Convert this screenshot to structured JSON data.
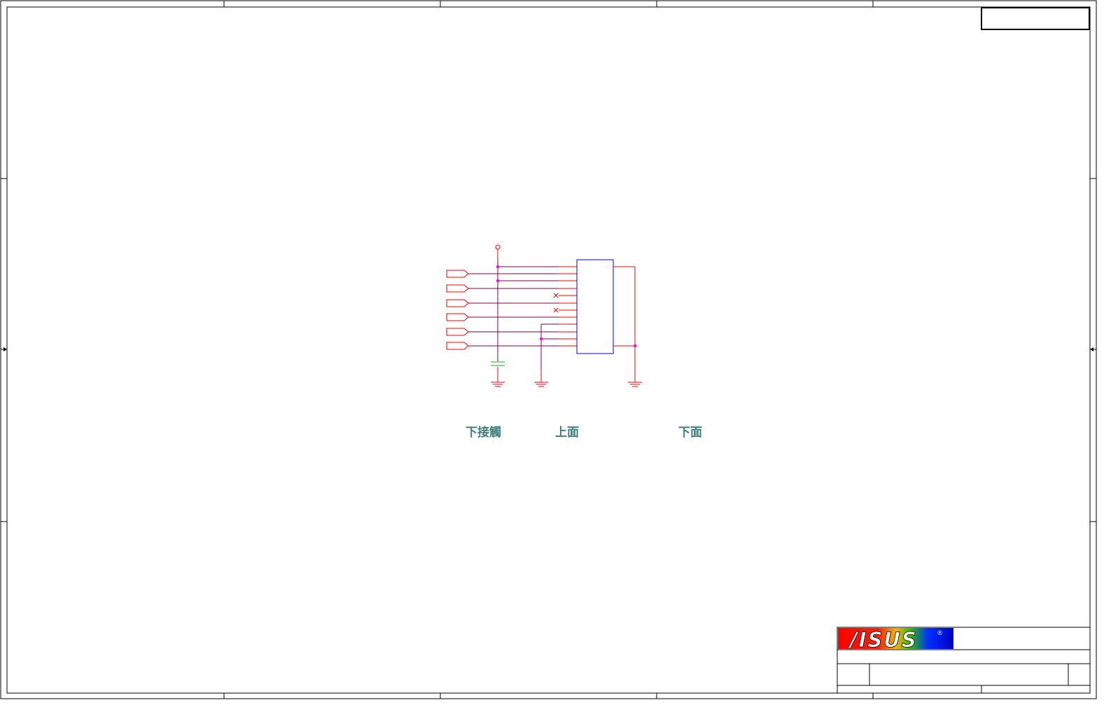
{
  "sheet": {
    "border_color": "#000000",
    "wire_color": "#800040",
    "pin_color": "#ff0000",
    "part_color": "#0000ff",
    "junction_color": "#ff00ff",
    "cap_color": "#00c000",
    "label_color": "#3c7f7f"
  },
  "labels": {
    "bottom_contact": "下接觸",
    "top_side": "上面",
    "bottom_side": "下面"
  },
  "title_block": {
    "logo_text": "/ISUS",
    "registered_mark": "®"
  }
}
